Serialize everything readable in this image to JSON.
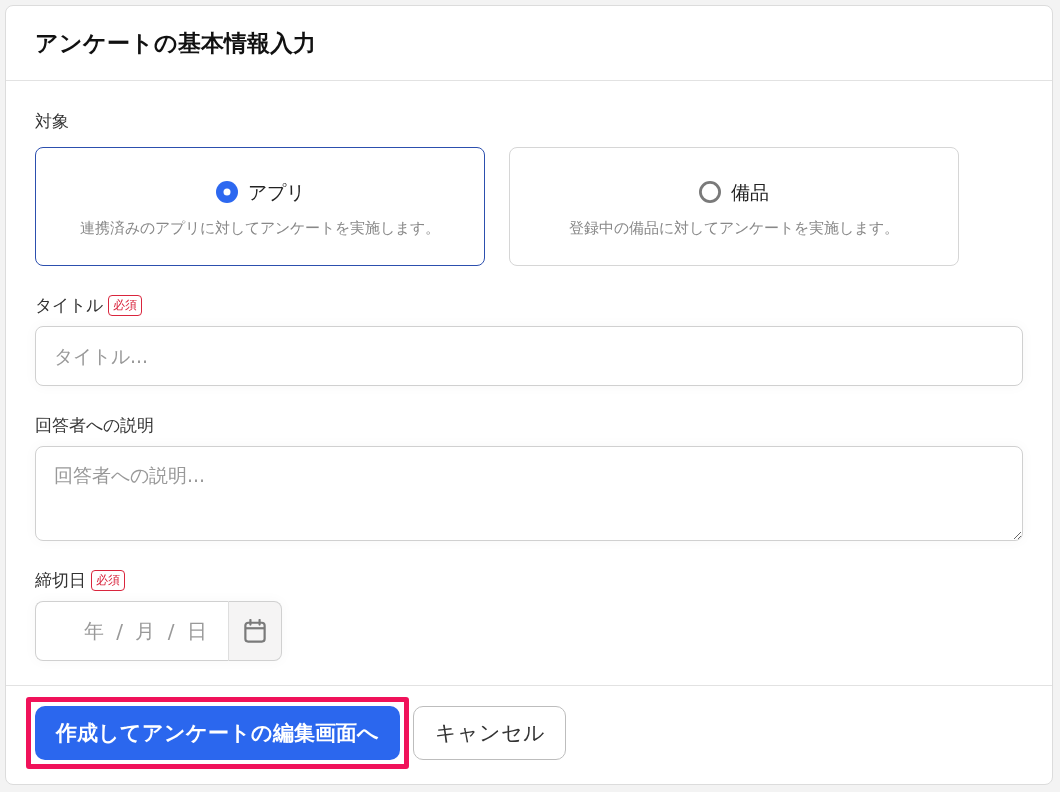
{
  "dialog": {
    "title": "アンケートの基本情報入力"
  },
  "target": {
    "label": "対象",
    "options": [
      {
        "label": "アプリ",
        "description": "連携済みのアプリに対してアンケートを実施します。",
        "selected": true
      },
      {
        "label": "備品",
        "description": "登録中の備品に対してアンケートを実施します。",
        "selected": false
      }
    ]
  },
  "fields": [
    {
      "kind": "text",
      "label": "タイトル",
      "badge": "必須",
      "placeholder": "タイトル..."
    },
    {
      "kind": "textarea",
      "label": "回答者への説明",
      "placeholder": "回答者への説明..."
    },
    {
      "kind": "date",
      "label": "締切日",
      "badge": "必須",
      "placeholder": "年 / 月 / 日"
    }
  ],
  "footer": {
    "buttons": [
      {
        "kind": "primary",
        "label": "作成してアンケートの編集画面へ",
        "highlighted": true
      },
      {
        "kind": "secondary",
        "label": "キャンセル",
        "highlighted": false
      }
    ]
  }
}
